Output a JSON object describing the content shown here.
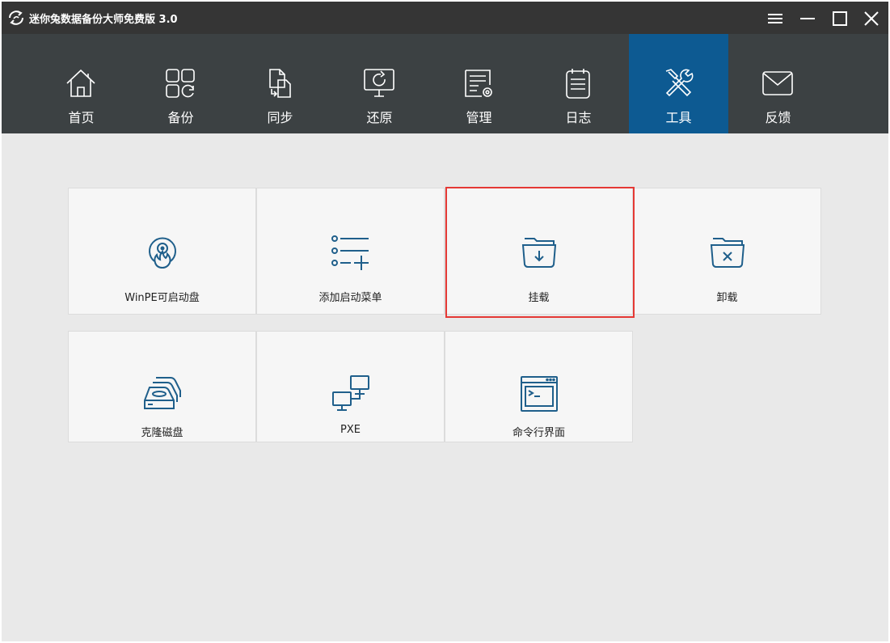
{
  "window": {
    "title": "迷你兔数据备份大师免费版 3.0"
  },
  "title_controls": [
    "menu-icon",
    "minimize-icon",
    "maximize-icon",
    "close-icon"
  ],
  "nav": {
    "items": [
      {
        "label": "首页",
        "icon": "home-icon"
      },
      {
        "label": "备份",
        "icon": "backup-icon"
      },
      {
        "label": "同步",
        "icon": "sync-icon"
      },
      {
        "label": "还原",
        "icon": "restore-icon"
      },
      {
        "label": "管理",
        "icon": "manage-icon"
      },
      {
        "label": "日志",
        "icon": "log-icon"
      },
      {
        "label": "工具",
        "icon": "tools-icon",
        "active": true
      },
      {
        "label": "反馈",
        "icon": "feedback-icon"
      }
    ]
  },
  "tools": {
    "tiles": [
      {
        "label": "WinPE可启动盘",
        "icon": "bootable-disc-icon"
      },
      {
        "label": "添加启动菜单",
        "icon": "add-boot-menu-icon"
      },
      {
        "label": "挂载",
        "icon": "mount-folder-icon",
        "highlighted": true
      },
      {
        "label": "卸载",
        "icon": "unmount-folder-icon"
      },
      {
        "label": "克隆磁盘",
        "icon": "clone-disk-icon"
      },
      {
        "label": "PXE",
        "icon": "pxe-network-icon"
      },
      {
        "label": "命令行界面",
        "icon": "command-line-icon"
      }
    ]
  },
  "colors": {
    "titlebar": "#353535",
    "navbar": "#3c4143",
    "nav_active": "#0d5a92",
    "content_bg": "#e9e9e9",
    "tile_bg": "#f6f6f6",
    "icon_blue": "#1f5f8b",
    "highlight": "#e53935"
  }
}
